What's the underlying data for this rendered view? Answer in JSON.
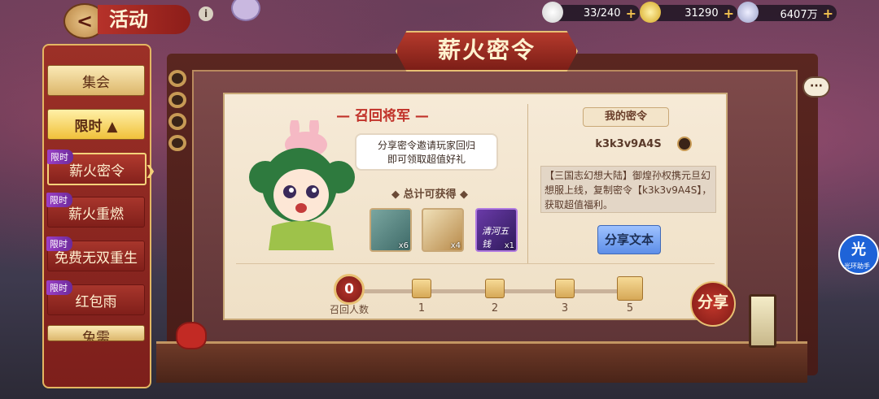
{
  "header": {
    "back_label": "<",
    "title": "活动",
    "info_label": "i"
  },
  "resources": [
    {
      "icon": "stamina-icon",
      "value": "33/240",
      "plus": "+"
    },
    {
      "icon": "gold-ingot-icon",
      "value": "31290",
      "plus": "+"
    },
    {
      "icon": "coin-icon",
      "value": "6407万",
      "plus": "+"
    }
  ],
  "menu": {
    "items": [
      {
        "label": "集会",
        "tag": ""
      },
      {
        "label": "限时 ▲",
        "tag": ""
      },
      {
        "label": "薪火密令",
        "tag": "限时"
      },
      {
        "label": "薪火重燃",
        "tag": "限时"
      },
      {
        "label": "免费无双重生",
        "tag": "限时"
      },
      {
        "label": "红包雨",
        "tag": "限时"
      },
      {
        "label": "兔需",
        "tag": ""
      }
    ]
  },
  "panel": {
    "title": "薪火密令",
    "left": {
      "section_title": "— 召回将军 —",
      "bubble_line1": "分享密令邀请玩家回归",
      "bubble_line2": "即可领取超值好礼",
      "total_label": "◆ 总计可获得 ◆",
      "rewards": [
        {
          "icon": "scroll-card-icon",
          "count": "x6"
        },
        {
          "icon": "book-icon",
          "count": "x4"
        },
        {
          "icon": "purple-card-icon",
          "count": "x1",
          "text": "清河五钱"
        }
      ]
    },
    "right": {
      "title": "我的密令",
      "code": "k3k3v9A4S",
      "description": "【三国志幻想大陆】御煌孙权携元旦幻想服上线，复制密令【k3k3v9A4S】，获取超值福利。",
      "share_text_button": "分享文本"
    },
    "progress": {
      "current": "0",
      "current_label": "召回人数",
      "milestones": [
        "1",
        "2",
        "3",
        "5"
      ]
    },
    "share_button": "分享"
  },
  "helper": {
    "icon_text": "光",
    "label": "光环助手"
  },
  "chat_label": "···",
  "colors": {
    "accent_red": "#c1322a",
    "gold": "#e8c073",
    "blue_button": "#5d8ee8"
  }
}
